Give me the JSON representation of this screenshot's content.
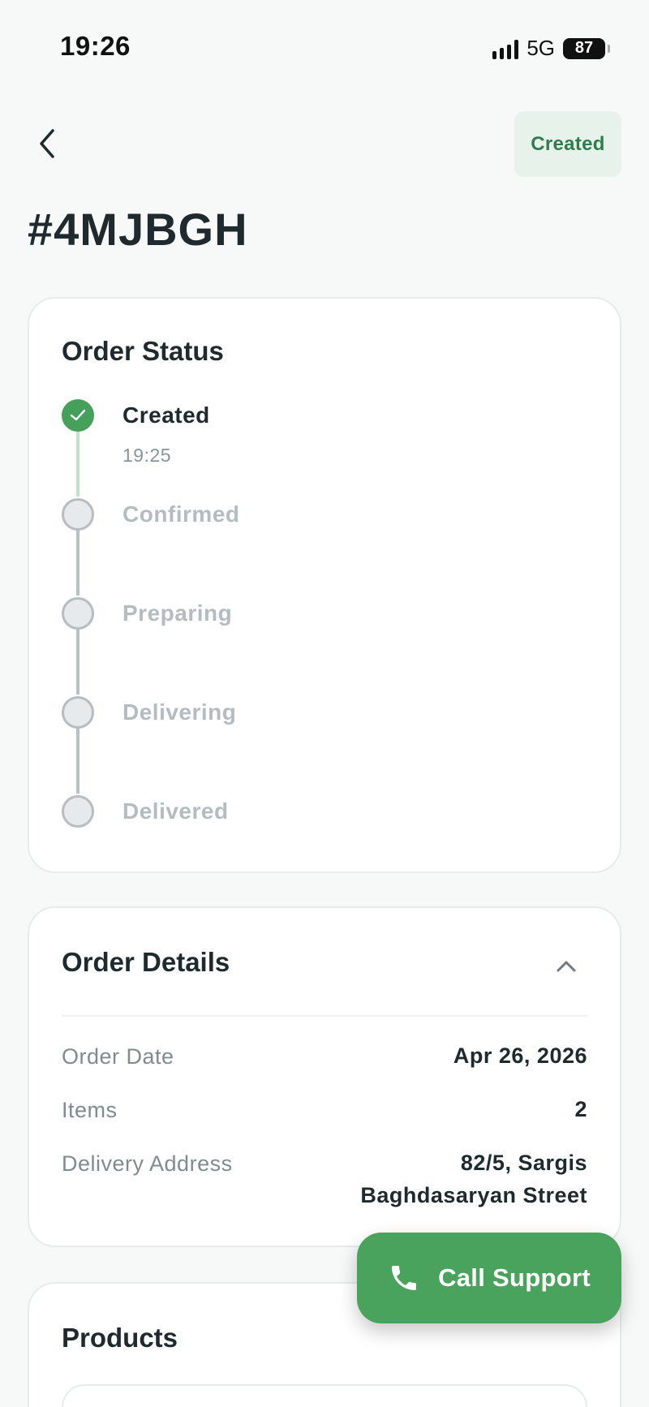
{
  "status_bar": {
    "time": "19:26",
    "network": "5G",
    "battery": "87"
  },
  "header": {
    "back_icon": "chevron-left-icon",
    "status_badge": "Created"
  },
  "order": {
    "id": "#4MJBGH"
  },
  "order_status": {
    "title": "Order Status",
    "steps": [
      {
        "label": "Created",
        "time": "19:25",
        "done": true
      },
      {
        "label": "Confirmed",
        "done": false
      },
      {
        "label": "Preparing",
        "done": false
      },
      {
        "label": "Delivering",
        "done": false
      },
      {
        "label": "Delivered",
        "done": false
      }
    ]
  },
  "order_details": {
    "title": "Order Details",
    "toggle_icon": "chevron-up-icon",
    "rows": [
      {
        "label": "Order Date",
        "value": "Apr 26, 2026"
      },
      {
        "label": "Items",
        "value": "2"
      },
      {
        "label": "Delivery Address",
        "value_line1": "82/5, Sargis",
        "value_line2": "Baghdasaryan Street"
      }
    ]
  },
  "products": {
    "title": "Products"
  },
  "call_support": {
    "label": "Call Support",
    "icon": "phone-icon"
  },
  "colors": {
    "accent": "#4aa35d",
    "badge_bg": "#e6f2ea",
    "badge_text": "#2f7d4f",
    "inactive": "#b5bcc0"
  }
}
